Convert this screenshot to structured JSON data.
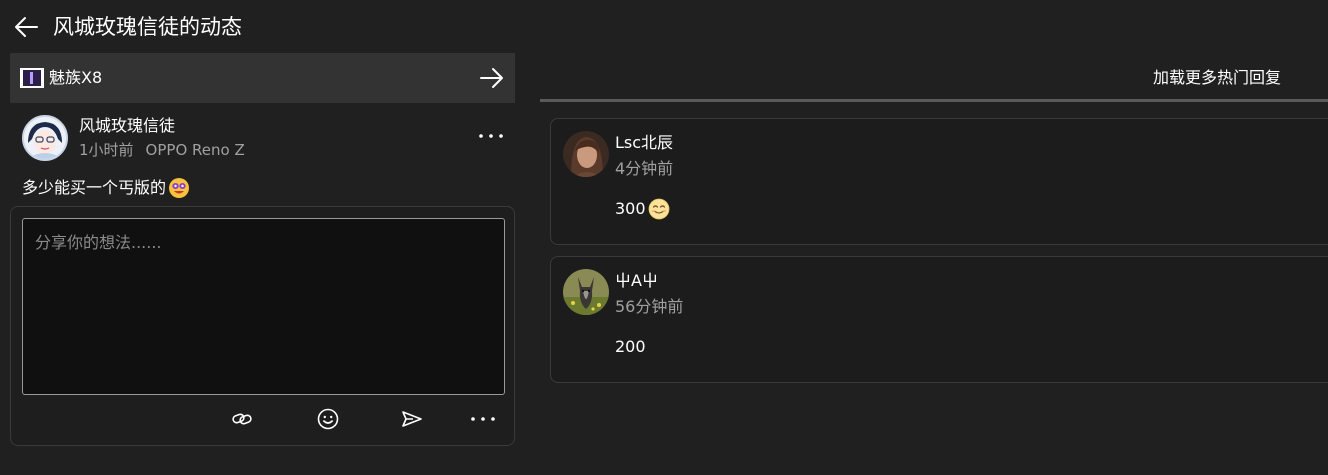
{
  "header": {
    "title": "风城玫瑰信徒的动态"
  },
  "topic": {
    "label": "魅族X8"
  },
  "post": {
    "author": "风城玫瑰信徒",
    "time": "1小时前",
    "device": "OPPO Reno Z",
    "content": "多少能买一个丐版的"
  },
  "reply_box": {
    "placeholder": "分享你的想法......"
  },
  "comments_section": {
    "load_more_label": "加载更多热门回复",
    "comments": [
      {
        "user": "Lsc北辰",
        "time": "4分钟前",
        "text": "300"
      },
      {
        "user": "屮A屮",
        "time": "56分钟前",
        "text": "200"
      }
    ]
  },
  "icons": {
    "back": "arrow-left-icon",
    "topic_go": "arrow-right-icon",
    "more": "more-horizontal-icon",
    "link": "link-icon",
    "emoji": "emoji-icon",
    "send": "send-icon"
  },
  "colors": {
    "background": "#202020",
    "topic_bar": "#333333",
    "card_background": "#1c1c1c",
    "secondary_text": "#a0a0a0",
    "input_background": "#101010"
  }
}
